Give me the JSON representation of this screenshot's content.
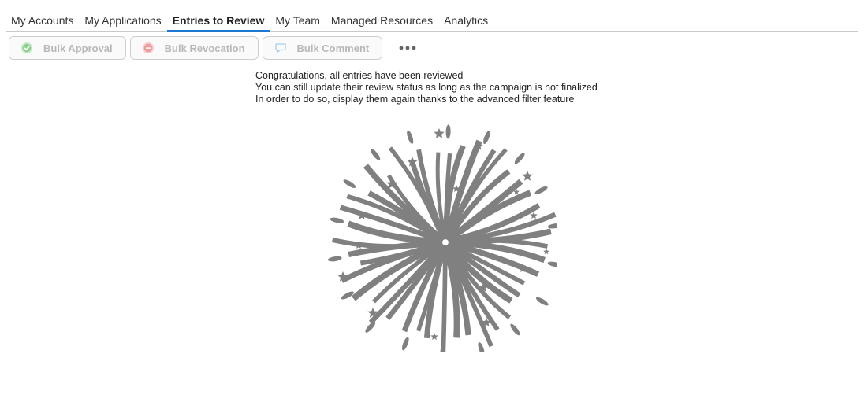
{
  "tabs": [
    {
      "label": "My Accounts"
    },
    {
      "label": "My Applications"
    },
    {
      "label": "Entries to Review"
    },
    {
      "label": "My Team"
    },
    {
      "label": "Managed Resources"
    },
    {
      "label": "Analytics"
    }
  ],
  "active_tab": "Entries to Review",
  "toolbar": {
    "bulk_approval": "Bulk Approval",
    "bulk_revocation": "Bulk Revocation",
    "bulk_comment": "Bulk Comment",
    "more_icon": "ellipsis-icon",
    "disabled": true
  },
  "message": {
    "line1": "Congratulations, all entries have been reviewed",
    "line2": "You can still update their review status as long as the campaign is not finalized",
    "line3": "In order to do so, display them again thanks to the advanced filter feature"
  },
  "illustration": {
    "icon": "fireworks-icon",
    "color": "#808080"
  },
  "colors": {
    "accent": "#1f78d1",
    "approval_icon": "#7cc47c",
    "revocation_icon": "#ef8080",
    "comment_icon": "#9cc3ea"
  }
}
